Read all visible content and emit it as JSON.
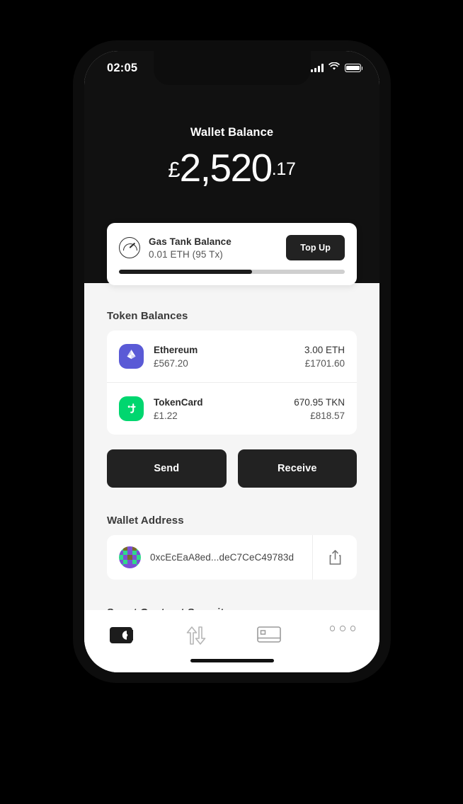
{
  "status_bar": {
    "time": "02:05",
    "signal_icon": "cellular-signal-icon",
    "wifi_icon": "wifi-icon",
    "battery_icon": "battery-full-icon"
  },
  "header": {
    "balance_label": "Wallet Balance",
    "currency_symbol": "£",
    "balance_whole": "2,520",
    "balance_decimal": ".17"
  },
  "gas_tank": {
    "icon": "gauge-icon",
    "title": "Gas Tank Balance",
    "subtitle": "0.01 ETH (95 Tx)",
    "top_up_label": "Top Up",
    "progress_percent": 59
  },
  "tokens": {
    "section_title": "Token Balances",
    "items": [
      {
        "icon": "ethereum-icon",
        "icon_color": "#5A5AD6",
        "name": "Ethereum",
        "price": "£567.20",
        "amount": "3.00 ETH",
        "value": "£1701.60"
      },
      {
        "icon": "tokencard-icon",
        "icon_color": "#00D66F",
        "name": "TokenCard",
        "price": "£1.22",
        "amount": "670.95 TKN",
        "value": "£818.57"
      }
    ]
  },
  "actions": {
    "send_label": "Send",
    "receive_label": "Receive"
  },
  "wallet_address": {
    "section_title": "Wallet Address",
    "identicon": "wallet-identicon",
    "address": "0xcEcEaA8ed...deC7CeC49783d",
    "share_icon": "share-icon"
  },
  "smart_contract": {
    "section_title": "Smart Contract Security"
  },
  "tabbar": {
    "items": [
      {
        "icon": "wallet-icon",
        "active": true
      },
      {
        "icon": "transfer-arrows-icon",
        "active": false
      },
      {
        "icon": "card-icon",
        "active": false
      },
      {
        "icon": "more-dots-icon",
        "active": false
      }
    ]
  },
  "theme": {
    "header_bg": "#111111",
    "page_bg": "#f5f5f5",
    "card_bg": "#ffffff",
    "accent_dark": "#222222"
  }
}
